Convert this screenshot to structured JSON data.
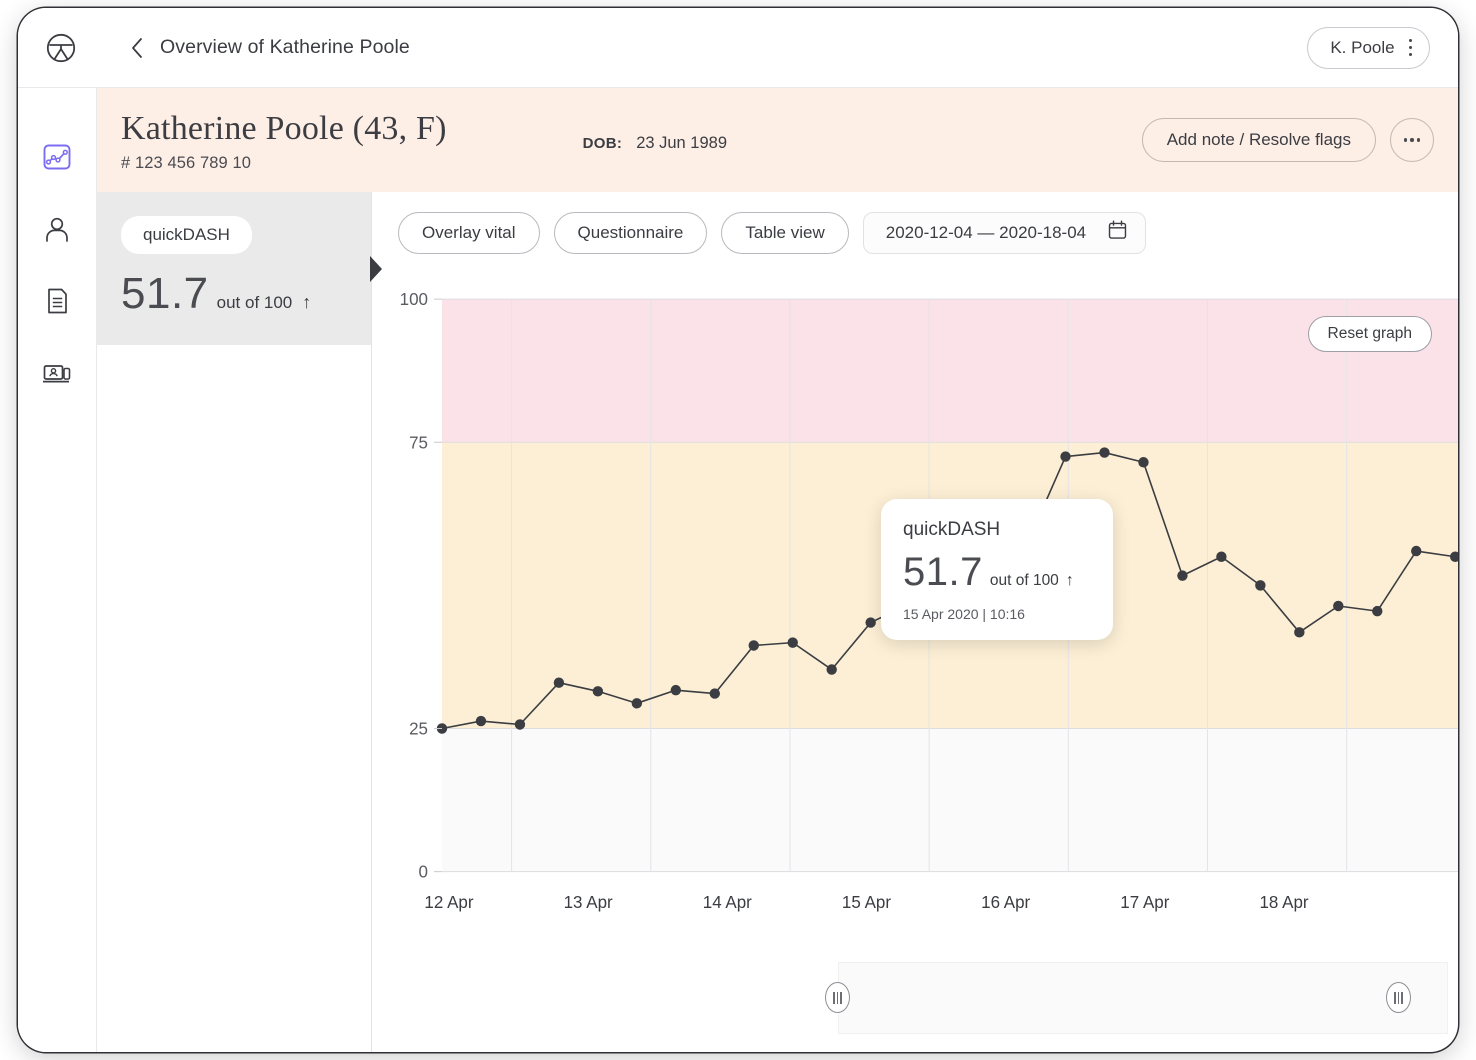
{
  "topbar": {
    "logo_icon": "clinic-logo-icon",
    "back_icon": "chevron-left-icon",
    "title": "Overview of Katherine Poole",
    "user_chip_label": "K. Poole",
    "user_chip_icon": "kebab-menu-icon"
  },
  "sidebar": {
    "items": [
      {
        "name": "charts",
        "icon": "line-chart-icon",
        "active": true
      },
      {
        "name": "profile",
        "icon": "person-icon",
        "active": false
      },
      {
        "name": "documents",
        "icon": "document-icon",
        "active": false
      },
      {
        "name": "telehealth",
        "icon": "video-consult-icon",
        "active": false
      }
    ],
    "active_color": "#7c6df0"
  },
  "patient": {
    "name_line": "Katherine Poole (43, F)",
    "id_line": "# 123 456 789 10",
    "dob_label": "DOB:",
    "dob_value": "23 Jun 1989",
    "add_note_button": "Add note / Resolve flags",
    "more_button_icon": "ellipsis-icon",
    "header_bg": "#fdeee6"
  },
  "score_list": {
    "cards": [
      {
        "chip": "quickDASH",
        "value": "51.7",
        "out_of": "out of 100",
        "trend": "↑",
        "selected": true
      }
    ]
  },
  "toolbar": {
    "overlay_vital": "Overlay vital",
    "questionnaire": "Questionnaire",
    "table_view": "Table view",
    "date_range": "2020-12-04 — 2020-18-04",
    "calendar_icon": "calendar-icon"
  },
  "chart_controls": {
    "reset_label": "Reset graph"
  },
  "tooltip": {
    "title": "quickDASH",
    "value": "51.7",
    "out_of": "out of 100",
    "trend": "↑",
    "timestamp": "15 Apr 2020 | 10:16"
  },
  "brush": {
    "left_handle_icon": "drag-handle-icon",
    "right_handle_icon": "drag-handle-icon"
  },
  "chart_data": {
    "type": "line",
    "title": "quickDASH",
    "xlabel": "",
    "ylabel": "",
    "ylim": [
      0,
      100
    ],
    "yticks": [
      0,
      25,
      75,
      100
    ],
    "ytick_labels": [
      "0",
      "25",
      "75",
      "100"
    ],
    "xtick_labels": [
      "12 Apr",
      "13 Apr",
      "14 Apr",
      "15 Apr",
      "16 Apr",
      "17 Apr",
      "18 Apr"
    ],
    "grid": true,
    "legend": "none",
    "line_color": "#3b3d42",
    "marker_color": "#3b3d42",
    "bands": [
      {
        "name": "high",
        "from": 75,
        "to": 100,
        "color": "#fbe1e8"
      },
      {
        "name": "moderate",
        "from": 25,
        "to": 75,
        "color": "#fcefd5"
      },
      {
        "name": "low",
        "from": 0,
        "to": 25,
        "color": "#fafafa"
      }
    ],
    "series": [
      {
        "name": "quickDASH",
        "x": [
          0.0,
          0.28,
          0.56,
          0.84,
          1.12,
          1.4,
          1.68,
          1.96,
          2.24,
          2.52,
          2.8,
          3.08,
          3.36,
          3.64,
          3.92,
          4.2,
          4.48,
          4.76,
          5.04,
          5.32,
          5.6,
          5.88,
          6.16,
          6.44,
          6.72,
          7.0,
          7.28
        ],
        "values": [
          25.0,
          26.3,
          25.7,
          33.0,
          31.5,
          29.4,
          31.7,
          31.1,
          39.5,
          40.0,
          35.3,
          43.5,
          46.8,
          46.0,
          54.0,
          57.0,
          72.5,
          73.2,
          71.5,
          51.7,
          55.0,
          50.0,
          41.8,
          46.4,
          45.5,
          56.0,
          55.0
        ],
        "highlighted_index": 19
      }
    ]
  }
}
